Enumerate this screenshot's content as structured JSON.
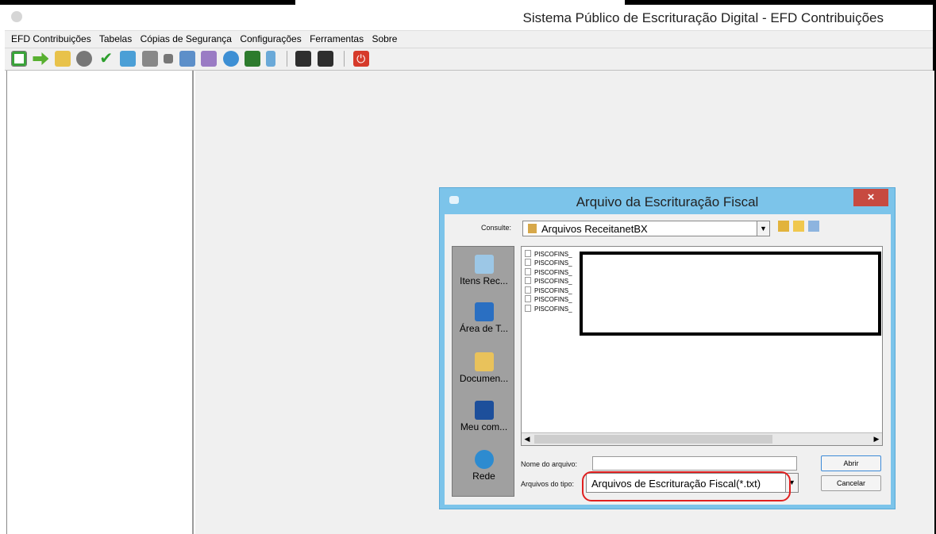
{
  "window": {
    "title": "Sistema Público de Escrituração Digital - EFD Contribuições"
  },
  "menu": {
    "items": [
      "EFD Contribuições",
      "Tabelas",
      "Cópias de Segurança",
      "Configurações",
      "Ferramentas",
      "Sobre"
    ]
  },
  "toolbar": {
    "icons": [
      "new-file-icon",
      "import-icon",
      "open-folder-icon",
      "gears-icon",
      "check-icon",
      "export-icon",
      "delete-icon",
      "stop-icon",
      "edit-doc-icon",
      "tools-doc-icon",
      "globe-icon",
      "mail-icon",
      "shield-icon",
      "save-icon",
      "save-as-icon",
      "power-icon"
    ]
  },
  "dialog": {
    "title": "Arquivo da Escrituração Fiscal",
    "look_in_label": "Consulte:",
    "look_in_value": "Arquivos ReceitanetBX",
    "places": [
      {
        "label": "Itens Rec...",
        "icon": "recent-items-icon"
      },
      {
        "label": "Área de T...",
        "icon": "desktop-icon"
      },
      {
        "label": "Documen...",
        "icon": "documents-icon"
      },
      {
        "label": "Meu com...",
        "icon": "computer-icon"
      },
      {
        "label": "Rede",
        "icon": "network-icon"
      }
    ],
    "files": [
      "PISCOFINS_",
      "PISCOFINS_",
      "PISCOFINS_",
      "PISCOFINS_",
      "PISCOFINS_",
      "PISCOFINS_",
      "PISCOFINS_"
    ],
    "filename_label": "Nome do arquivo:",
    "filename_value": "",
    "filetype_label": "Arquivos do tipo:",
    "filetype_value": "Arquivos de Escrituração Fiscal(*.txt)",
    "open_label": "Abrir",
    "cancel_label": "Cancelar",
    "close_label": "×"
  },
  "colors": {
    "dialog_frame": "#7cc4ea",
    "close_button": "#c74a40",
    "highlight": "#e02020"
  }
}
